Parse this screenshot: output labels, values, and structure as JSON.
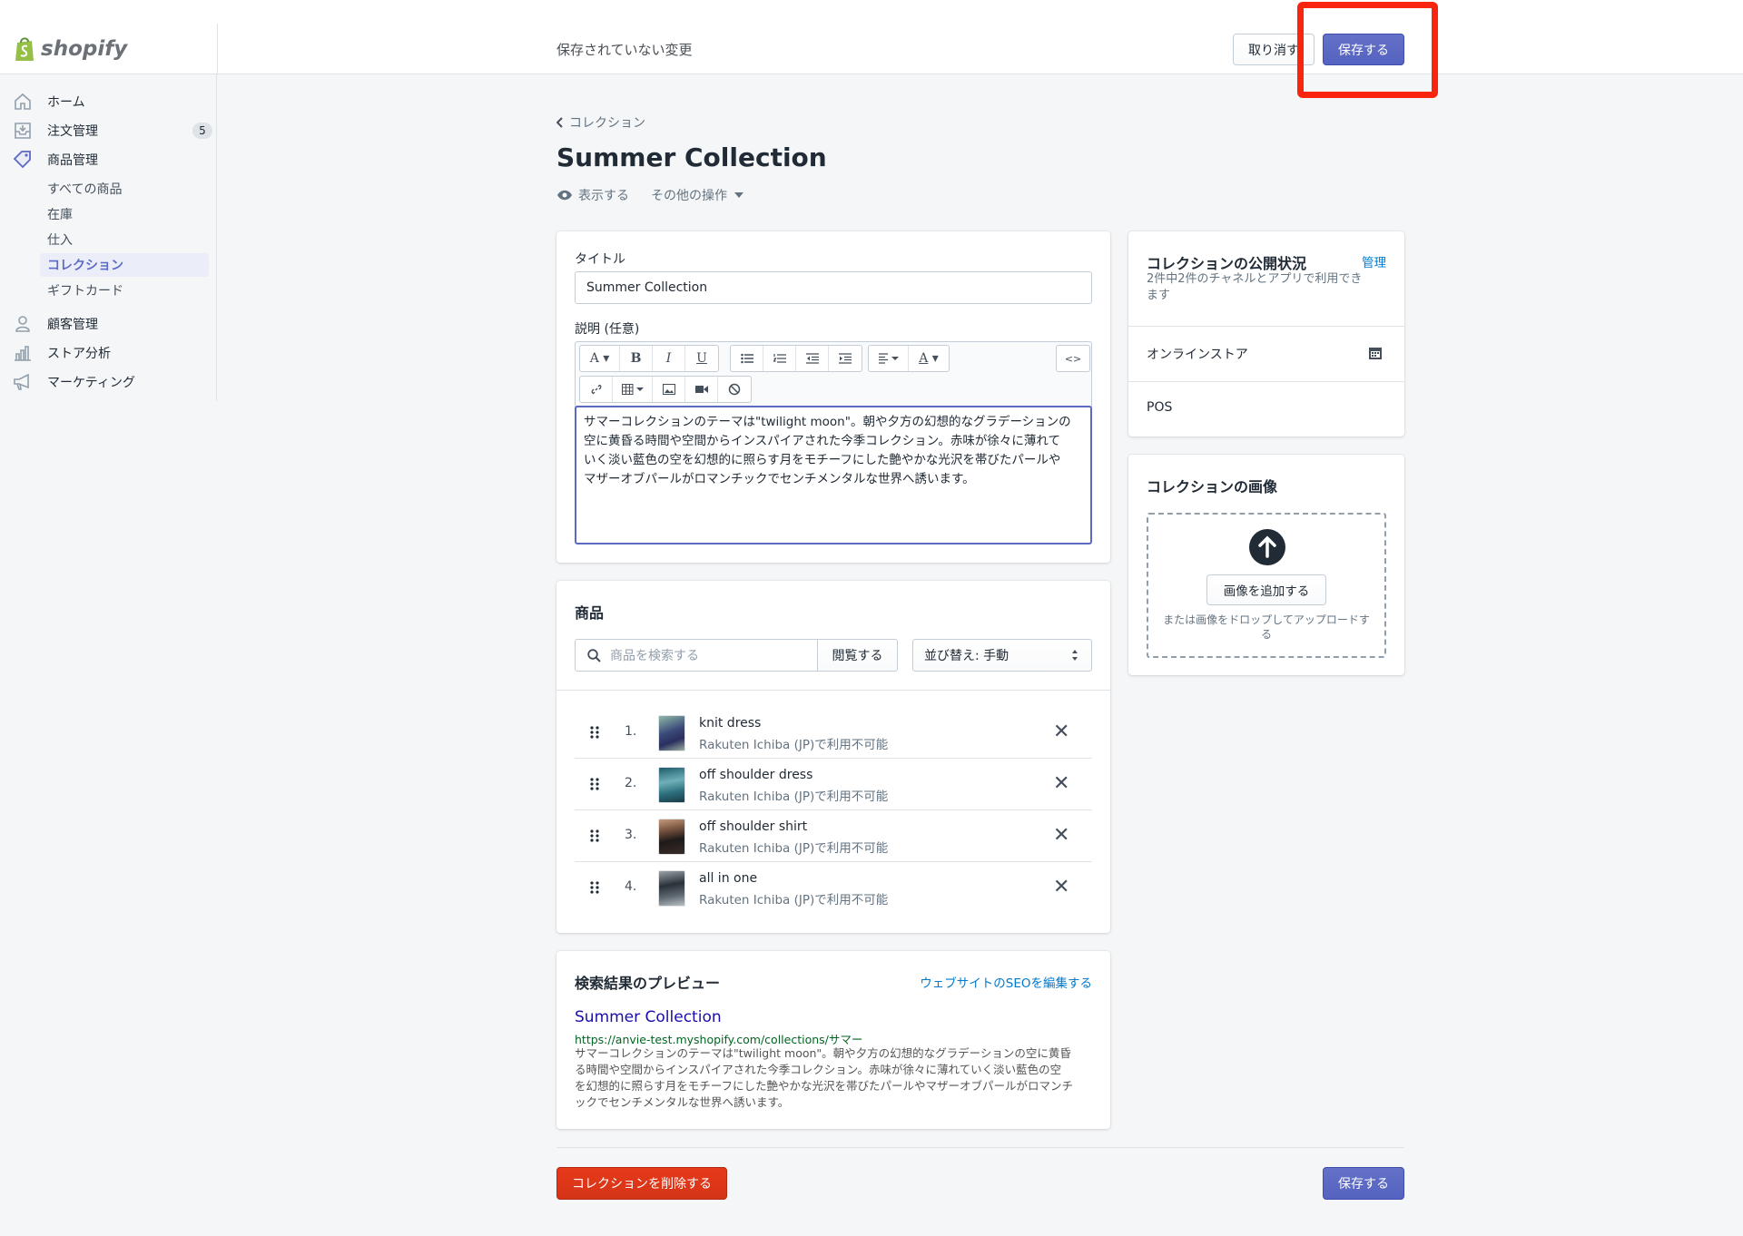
{
  "app": {
    "logo_text": "shopify"
  },
  "topbar": {
    "unsaved_text": "保存されていない変更",
    "discard_label": "取り消す",
    "save_label": "保存する"
  },
  "sidebar": {
    "items": [
      {
        "label": "ホーム",
        "icon": "home-icon"
      },
      {
        "label": "注文管理",
        "icon": "orders-icon",
        "badge": "5"
      },
      {
        "label": "商品管理",
        "icon": "tag-icon"
      },
      {
        "label": "顧客管理",
        "icon": "customer-icon"
      },
      {
        "label": "ストア分析",
        "icon": "analytics-icon"
      },
      {
        "label": "マーケティング",
        "icon": "megaphone-icon"
      }
    ],
    "product_sub": [
      "すべての商品",
      "在庫",
      "仕入",
      "コレクション",
      "ギフトカード"
    ],
    "active_sub": "コレクション"
  },
  "breadcrumb": "コレクション",
  "page": {
    "title": "Summer Collection",
    "view_label": "表示する",
    "more_actions_label": "その他の操作"
  },
  "form": {
    "title_label": "タイトル",
    "title_value": "Summer Collection",
    "description_label": "説明 (任意)",
    "description_lines": [
      "サマーコレクションのテーマは\"twilight moon\"。朝や夕方の幻想的なグラデーションの",
      "空に黄昏る時間や空間からインスパイアされた今季コレクション。赤味が徐々に薄れて",
      "いく淡い藍色の空を幻想的に照らす月をモチーフにした艶やかな光沢を帯びたパールや",
      "マザーオブパールがロマンチックでセンチメンタルな世界へ誘います。"
    ]
  },
  "products": {
    "heading": "商品",
    "search_placeholder": "商品を検索する",
    "browse_label": "閲覧する",
    "sort_label": "並び替え: 手動",
    "items": [
      {
        "num": "1.",
        "name": "knit dress",
        "availability": "Rakuten Ichiba (JP)で利用不可能"
      },
      {
        "num": "2.",
        "name": "off shoulder dress",
        "availability": "Rakuten Ichiba (JP)で利用不可能"
      },
      {
        "num": "3.",
        "name": "off shoulder shirt",
        "availability": "Rakuten Ichiba (JP)で利用不可能"
      },
      {
        "num": "4.",
        "name": "all in one",
        "availability": "Rakuten Ichiba (JP)で利用不可能"
      }
    ]
  },
  "seo": {
    "heading": "検索結果のプレビュー",
    "edit_link": "ウェブサイトのSEOを編集する",
    "title": "Summer Collection",
    "url": "https://anvie-test.myshopify.com/collections/サマー",
    "desc_lines": [
      "サマーコレクションのテーマは\"twilight moon\"。朝や夕方の幻想的なグラデーションの空に黄昏",
      "る時間や空間からインスパイアされた今季コレクション。赤味が徐々に薄れていく淡い藍色の空",
      "を幻想的に照らす月をモチーフにした艶やかな光沢を帯びたパールやマザーオブパールがロマンチ",
      "ックでセンチメンタルな世界へ誘います。"
    ]
  },
  "availability": {
    "heading": "コレクションの公開状況",
    "manage_link": "管理",
    "subtext_lines": [
      "2件中2件のチャネルとアプリで利用でき",
      "ます"
    ],
    "channels": [
      "オンラインストア",
      "POS"
    ]
  },
  "image_card": {
    "heading": "コレクションの画像",
    "add_label": "画像を追加する",
    "drop_lines": [
      "または画像をドロップしてアップロードす",
      "る"
    ]
  },
  "footer": {
    "delete_label": "コレクションを削除する",
    "save_label": "保存する"
  },
  "colors": {
    "primary": "#5c6ac4",
    "danger": "#de3618",
    "highlight": "#f9250f",
    "link": "#007ace",
    "seo_title": "#1a0dab",
    "seo_url": "#006621"
  }
}
